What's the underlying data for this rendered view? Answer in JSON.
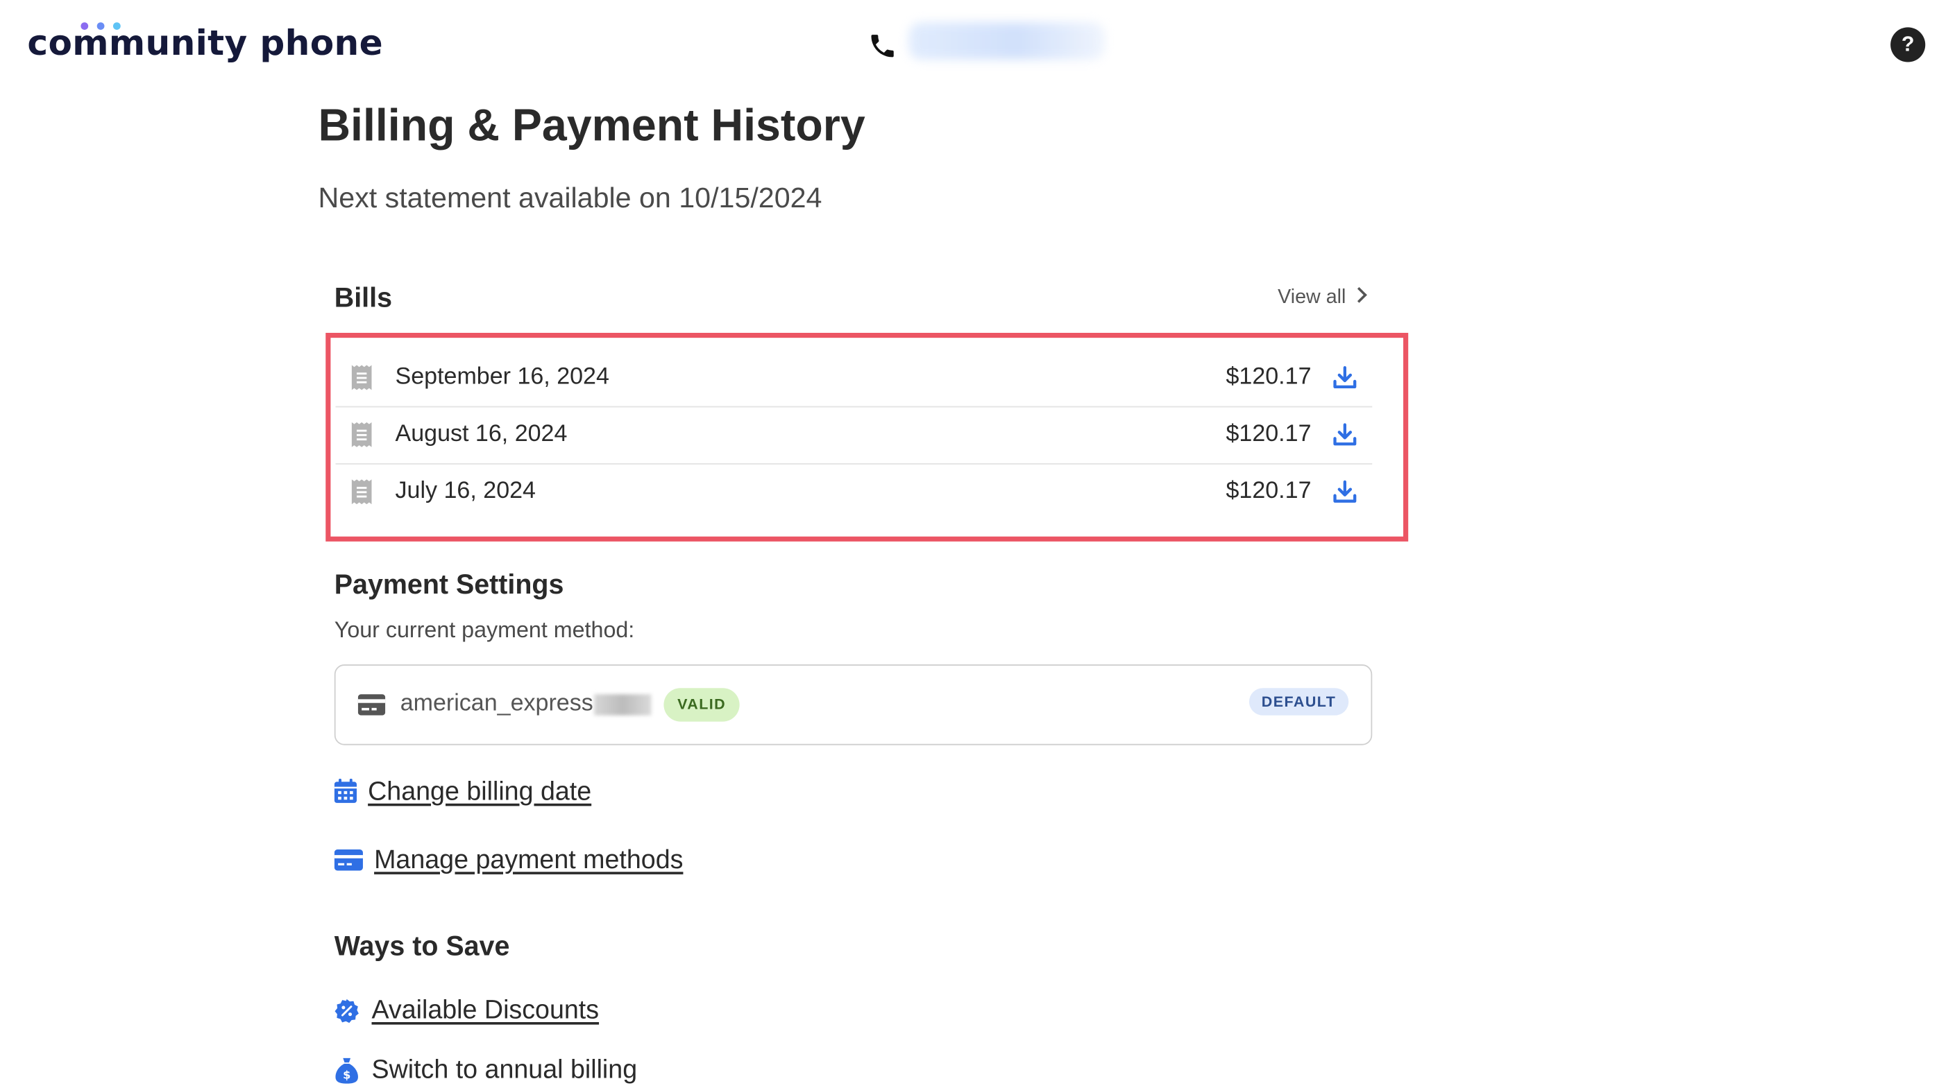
{
  "header": {
    "logo_text": "community phone",
    "logo_dot_colors": [
      "#8b6cf0",
      "#6a8df5",
      "#5ec3f5"
    ],
    "phone_icon": "phone-icon",
    "help_label": "?"
  },
  "page": {
    "title": "Billing & Payment History",
    "next_statement": "Next statement available on 10/15/2024"
  },
  "bills": {
    "heading": "Bills",
    "view_all": "View all",
    "highlight_color": "#ec5564",
    "items": [
      {
        "date": "September 16, 2024",
        "amount": "$120.17"
      },
      {
        "date": "August 16, 2024",
        "amount": "$120.17"
      },
      {
        "date": "July 16, 2024",
        "amount": "$120.17"
      }
    ]
  },
  "payment_settings": {
    "heading": "Payment Settings",
    "current_method_label": "Your current payment method:",
    "method": {
      "name": "american_express",
      "status_badge": "VALID",
      "default_badge": "DEFAULT"
    },
    "links": {
      "change_billing_date": "Change billing date",
      "manage_payment_methods": "Manage payment methods"
    }
  },
  "ways_to_save": {
    "heading": "Ways to Save",
    "available_discounts": "Available Discounts",
    "switch_annual": "Switch to annual billing"
  },
  "colors": {
    "accent_blue": "#2f6fe4",
    "text_dark": "#2a2a2a"
  }
}
